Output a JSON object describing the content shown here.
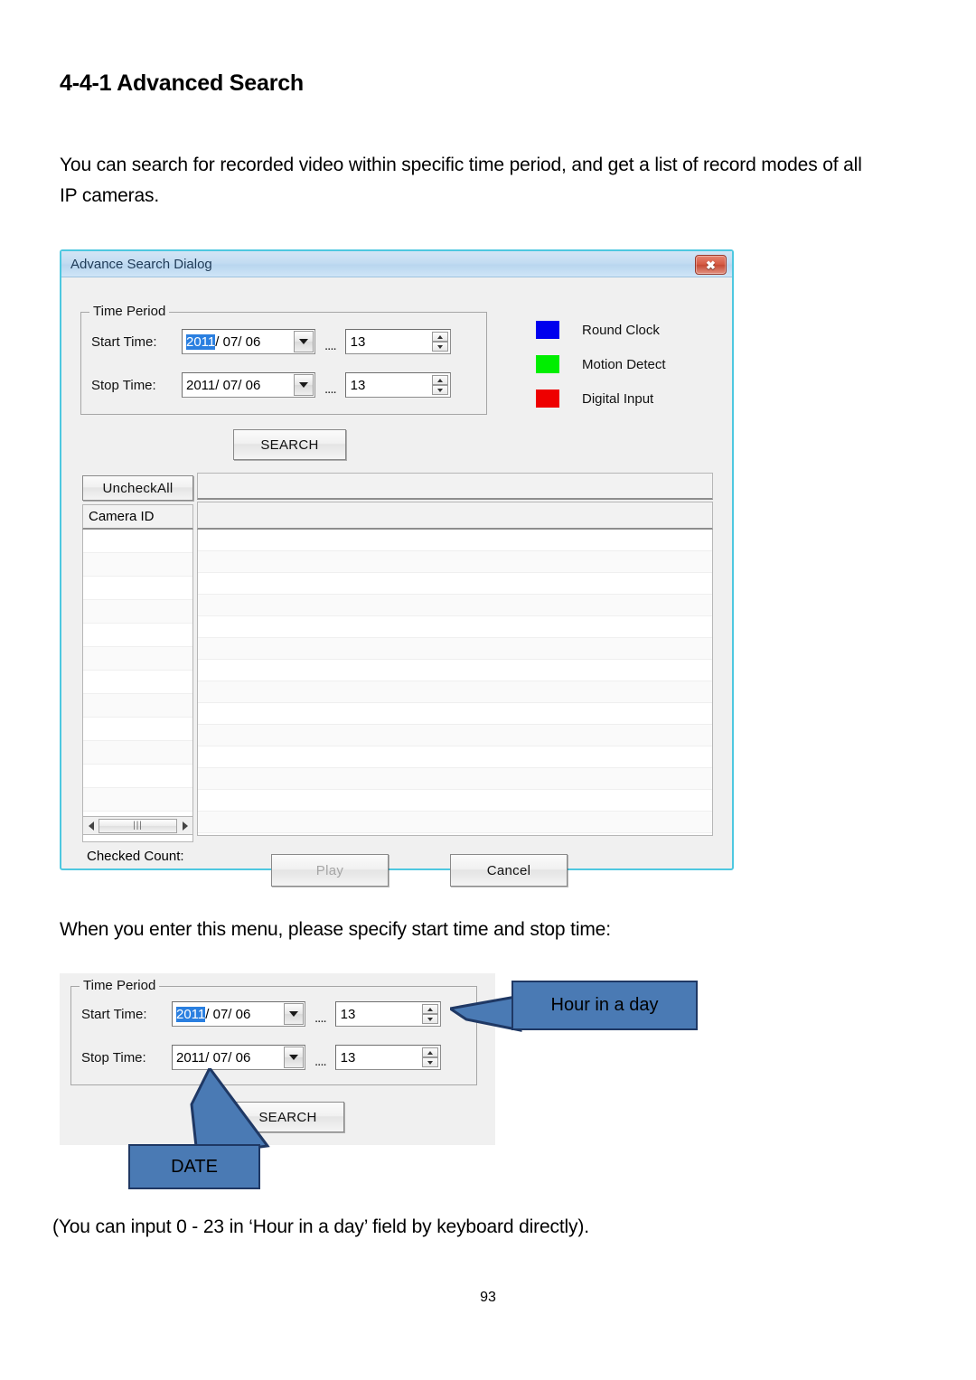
{
  "document": {
    "heading": "4-4-1 Advanced Search",
    "intro_paragraph": "You can search for recorded video within specific time period, and get a list of record modes of all IP cameras.",
    "specify_paragraph": "When you enter this menu, please specify start time and stop time:",
    "keyboard_paragraph": "(You can input 0 - 23 in ‘Hour in a day’ field by keyboard directly).",
    "page_number": "93"
  },
  "dialog": {
    "title": "Advance Search Dialog",
    "close_glyph": "✖",
    "time_period": {
      "group_title": "Time Period",
      "start_label": "Start Time:",
      "stop_label": "Stop Time:",
      "start_date_selected": "2011",
      "start_date_rest": "/ 07/ 06",
      "stop_date": "2011/ 07/ 06",
      "separator": "....",
      "start_hour": "13",
      "stop_hour": "13"
    },
    "legend": [
      {
        "label": "Round Clock",
        "color": "#0000ee"
      },
      {
        "label": "Motion Detect",
        "color": "#00ee00"
      },
      {
        "label": "Digital Input",
        "color": "#ee0000"
      }
    ],
    "search_button": "SEARCH",
    "uncheck_all_button": "UncheckAll",
    "camera_id_header": "Camera ID",
    "scroll_thumb_glyph": "⫿ff",
    "checked_count_label": "Checked Count:",
    "play_button": "Play",
    "cancel_button": "Cancel",
    "left_rows": 13,
    "right_rows": 14
  },
  "annotated_panel": {
    "time_period": {
      "group_title": "Time Period",
      "start_label": "Start Time:",
      "stop_label": "Stop Time:",
      "start_date_selected": "2011",
      "start_date_rest": "/ 07/ 06",
      "stop_date": "2011/ 07/ 06",
      "separator": "....",
      "start_hour": "13",
      "stop_hour": "13"
    },
    "search_button": "SEARCH",
    "callouts": [
      {
        "label": "Hour in a day",
        "fill": "#4a7ab4",
        "border": "#1f3864"
      },
      {
        "label": "DATE",
        "fill": "#4a7ab4",
        "border": "#1f3864"
      }
    ]
  }
}
